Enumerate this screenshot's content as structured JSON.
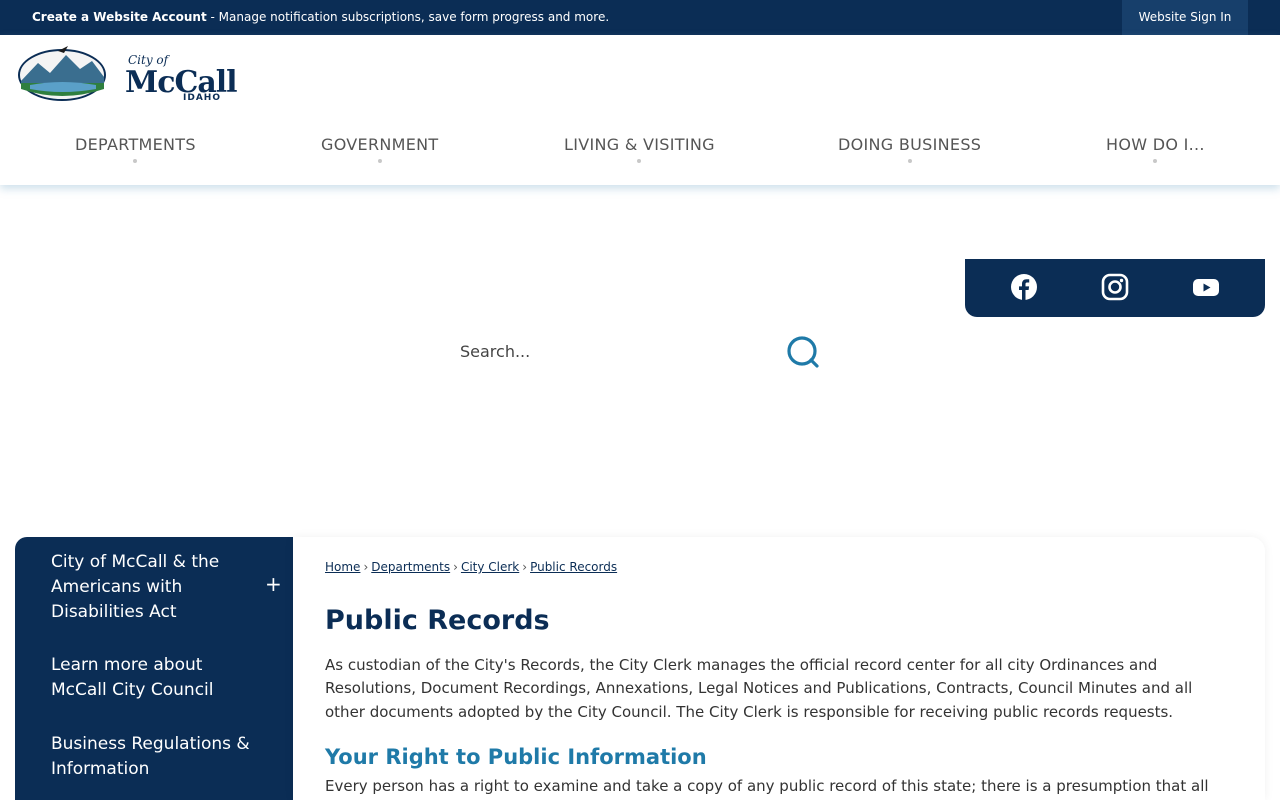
{
  "topbar": {
    "promo_bold": "Create a Website Account",
    "promo_rest": " - Manage notification subscriptions, save form progress and more.",
    "signin": "Website Sign In"
  },
  "logo": {
    "small": "City of",
    "big": "McCall",
    "state": "IDAHO"
  },
  "nav": {
    "items": [
      {
        "label": "DEPARTMENTS"
      },
      {
        "label": "GOVERNMENT"
      },
      {
        "label": "LIVING & VISITING"
      },
      {
        "label": "DOING BUSINESS"
      },
      {
        "label": "HOW DO I..."
      }
    ]
  },
  "social": {
    "icons": [
      "facebook-icon",
      "instagram-icon",
      "youtube-icon"
    ]
  },
  "search": {
    "placeholder": "Search..."
  },
  "sidebar": {
    "items": [
      {
        "label": "City of McCall & the Americans with Disabilities Act",
        "toggle": "+"
      },
      {
        "label": "Learn more about McCall City Council"
      },
      {
        "label": "Business Regulations & Information"
      }
    ]
  },
  "breadcrumb": {
    "items": [
      "Home",
      "Departments",
      "City Clerk",
      "Public Records"
    ],
    "separator": "›"
  },
  "main": {
    "title": "Public Records",
    "intro": "As custodian of the City's Records, the City Clerk manages the official record center for all city Ordinances and Resolutions, Document Recordings, Annexations, Legal Notices and Publications, Contracts, Council Minutes and all other documents adopted by the City Council. The City Clerk is responsible for receiving public records requests.",
    "subheading": "Your Right to Public Information",
    "para2": "Every person has a right to examine and take a copy of any public record of this state; there is a presumption that all"
  },
  "colors": {
    "navy": "#0b2d55",
    "accent_blue": "#1f7aa8"
  }
}
